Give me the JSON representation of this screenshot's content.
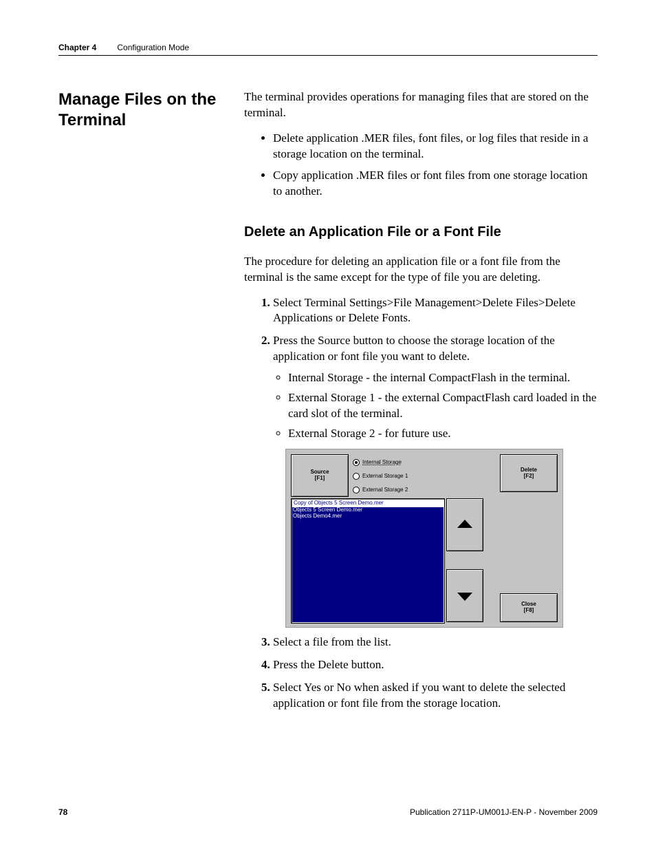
{
  "header": {
    "chapter": "Chapter 4",
    "title": "Configuration Mode"
  },
  "section_title": "Manage Files on the Terminal",
  "intro": "The terminal provides operations for managing files that are stored on the terminal.",
  "intro_bullets": [
    "Delete application .MER files, font files, or log files that reside in a storage location on the terminal.",
    "Copy application .MER files or font files from one storage location to another."
  ],
  "subheading": "Delete an Application File or a Font File",
  "sub_intro": "The procedure for deleting an application file or a font file from the terminal is the same except for the type of file you are deleting.",
  "steps": {
    "s1": "Select Terminal Settings>File Management>Delete Files>Delete Applications or Delete Fonts.",
    "s2": "Press the Source button to choose the storage location of the application or font file you want to delete.",
    "s2_bullets": [
      "Internal Storage - the internal CompactFlash in the terminal.",
      "External Storage 1 - the external CompactFlash card loaded in the card slot of the terminal.",
      "External Storage 2 - for future use."
    ],
    "s3": "Select a file from the list.",
    "s4": "Press the Delete button.",
    "s5": "Select Yes or No when asked if you want to delete the selected application or font file from the storage location."
  },
  "figure": {
    "source_btn": {
      "label": "Source",
      "key": "[F1]"
    },
    "radios": [
      {
        "label": "Internal Storage",
        "selected": true
      },
      {
        "label": "External Storage 1",
        "selected": false
      },
      {
        "label": "External Storage 2",
        "selected": false
      }
    ],
    "delete_btn": {
      "label": "Delete",
      "key": "[F2]"
    },
    "close_btn": {
      "label": "Close",
      "key": "[F8]"
    },
    "files": [
      "Copy of Objects 5 Screen Demo.mer",
      "Objects 5 Screen Demo.mer",
      "Objects Demo4.mer"
    ]
  },
  "footer": {
    "page": "78",
    "pub": "Publication 2711P-UM001J-EN-P - November 2009"
  }
}
